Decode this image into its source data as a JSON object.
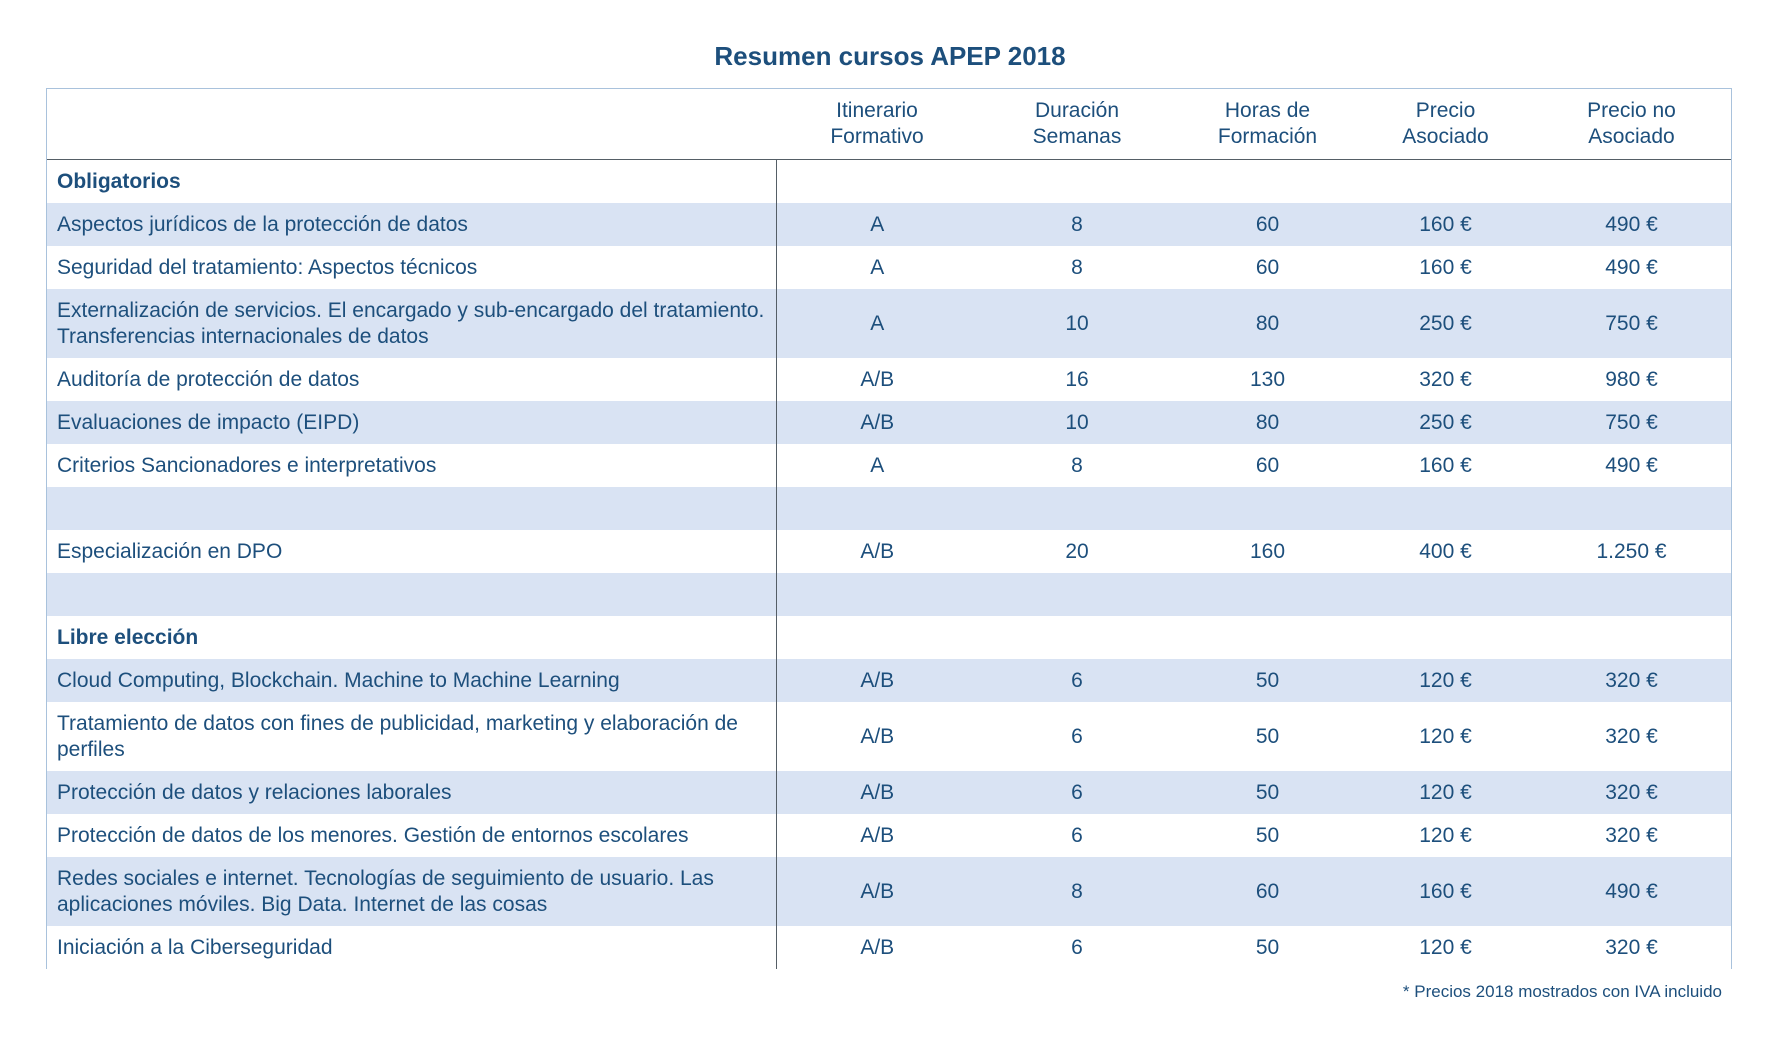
{
  "title": "Resumen cursos APEP 2018",
  "columns": [
    "",
    "Itinerario\nFormativo",
    "Duración\nSemanas",
    "Horas de\nFormación",
    "Precio\nAsociado",
    "Precio no\nAsociado"
  ],
  "headers": {
    "itinerario_l1": "Itinerario",
    "itinerario_l2": "Formativo",
    "duracion_l1": "Duración",
    "duracion_l2": "Semanas",
    "horas_l1": "Horas de",
    "horas_l2": "Formación",
    "pa_l1": "Precio",
    "pa_l2": "Asociado",
    "pna_l1": "Precio no",
    "pna_l2": "Asociado"
  },
  "rows": [
    {
      "type": "section",
      "name": "Obligatorios"
    },
    {
      "type": "course",
      "name": "Aspectos jurídicos de la protección de datos",
      "itinerario": "A",
      "duracion": "8",
      "horas": "60",
      "precio_asociado": "160 €",
      "precio_no_asociado": "490 €"
    },
    {
      "type": "course",
      "name": "Seguridad del tratamiento: Aspectos técnicos",
      "itinerario": "A",
      "duracion": "8",
      "horas": "60",
      "precio_asociado": "160 €",
      "precio_no_asociado": "490 €"
    },
    {
      "type": "course",
      "name": "Externalización de servicios. El encargado y sub-encargado del tratamiento. Transferencias internacionales de datos",
      "itinerario": "A",
      "duracion": "10",
      "horas": "80",
      "precio_asociado": "250 €",
      "precio_no_asociado": "750 €"
    },
    {
      "type": "course",
      "name": "Auditoría de protección de datos",
      "itinerario": "A/B",
      "duracion": "16",
      "horas": "130",
      "precio_asociado": "320 €",
      "precio_no_asociado": "980 €"
    },
    {
      "type": "course",
      "name": "Evaluaciones de impacto (EIPD)",
      "itinerario": "A/B",
      "duracion": "10",
      "horas": "80",
      "precio_asociado": "250 €",
      "precio_no_asociado": "750 €"
    },
    {
      "type": "course",
      "name": "Criterios Sancionadores e interpretativos",
      "itinerario": "A",
      "duracion": "8",
      "horas": "60",
      "precio_asociado": "160 €",
      "precio_no_asociado": "490 €"
    },
    {
      "type": "blank"
    },
    {
      "type": "course",
      "name": "Especialización en DPO",
      "itinerario": "A/B",
      "duracion": "20",
      "horas": "160",
      "precio_asociado": "400 €",
      "precio_no_asociado": "1.250 €"
    },
    {
      "type": "blank"
    },
    {
      "type": "section",
      "name": "Libre elección"
    },
    {
      "type": "course",
      "name": "Cloud Computing, Blockchain. Machine to Machine Learning",
      "itinerario": "A/B",
      "duracion": "6",
      "horas": "50",
      "precio_asociado": "120 €",
      "precio_no_asociado": "320 €"
    },
    {
      "type": "course",
      "name": "Tratamiento de datos con fines de publicidad, marketing y elaboración de perfiles",
      "itinerario": "A/B",
      "duracion": "6",
      "horas": "50",
      "precio_asociado": "120 €",
      "precio_no_asociado": "320 €"
    },
    {
      "type": "course",
      "name": "Protección de datos y relaciones laborales",
      "itinerario": "A/B",
      "duracion": "6",
      "horas": "50",
      "precio_asociado": "120 €",
      "precio_no_asociado": "320 €"
    },
    {
      "type": "course",
      "name": "Protección de datos de los menores. Gestión de entornos escolares",
      "itinerario": "A/B",
      "duracion": "6",
      "horas": "50",
      "precio_asociado": "120 €",
      "precio_no_asociado": "320 €"
    },
    {
      "type": "course",
      "name": "Redes sociales e internet. Tecnologías de seguimiento de usuario. Las aplicaciones móviles. Big Data. Internet de las cosas",
      "itinerario": "A/B",
      "duracion": "8",
      "horas": "60",
      "precio_asociado": "160 €",
      "precio_no_asociado": "490 €"
    },
    {
      "type": "course",
      "name": "Iniciación a la Ciberseguridad",
      "itinerario": "A/B",
      "duracion": "6",
      "horas": "50",
      "precio_asociado": "120 €",
      "precio_no_asociado": "320 €"
    }
  ],
  "footnote": "* Precios 2018 mostrados con IVA incluido",
  "colors": {
    "text": "#1d4f7c",
    "row_shade": "#d9e3f3",
    "border": "#a9c2dc"
  }
}
